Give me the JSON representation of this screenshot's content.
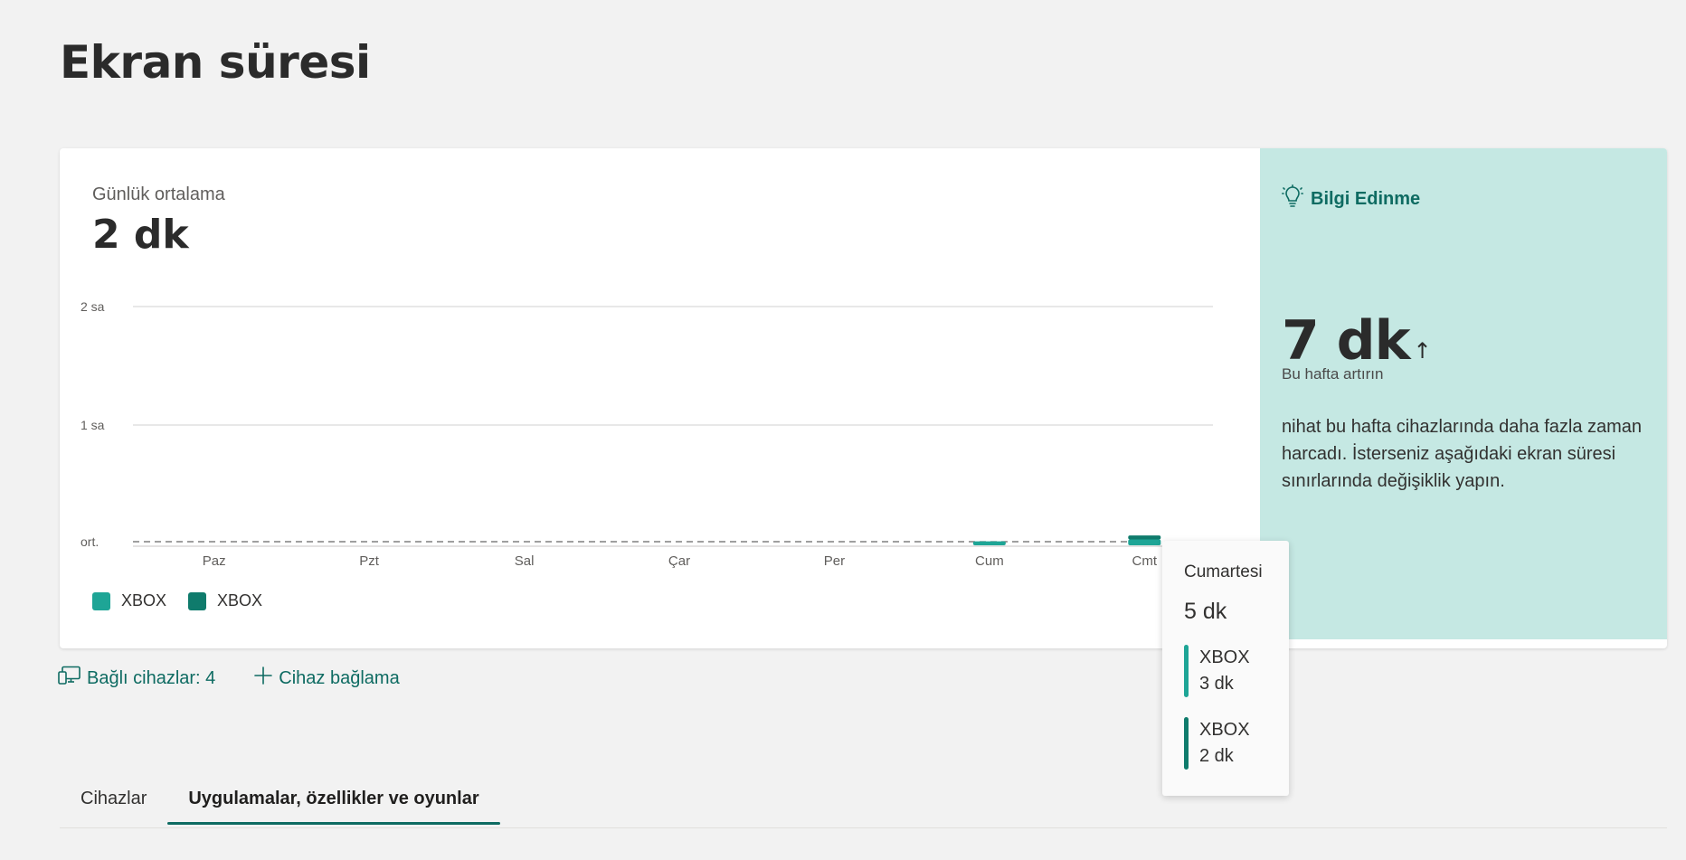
{
  "page": {
    "title": "Ekran süresi"
  },
  "summary": {
    "avg_label": "Günlük ortalama",
    "avg_value": "2 dk"
  },
  "chart_data": {
    "type": "bar",
    "stacked": true,
    "categories": [
      "Paz",
      "Pzt",
      "Sal",
      "Çar",
      "Per",
      "Cum",
      "Cmt"
    ],
    "y_ticks": [
      {
        "label": "2 sa",
        "minutes": 120
      },
      {
        "label": "1 sa",
        "minutes": 60
      }
    ],
    "avg_line": {
      "label": "ort.",
      "minutes": 2
    },
    "ylim": [
      0,
      120
    ],
    "series": [
      {
        "name": "XBOX",
        "color": "#1ea596",
        "values": [
          0,
          0,
          0,
          0,
          0,
          2,
          3
        ]
      },
      {
        "name": "XBOX",
        "color": "#0f7b6c",
        "values": [
          0,
          0,
          0,
          0,
          0,
          0,
          2
        ]
      }
    ]
  },
  "insight": {
    "title": "Bilgi Edinme",
    "value": "7 dk",
    "arrow": "↑",
    "subtitle": "Bu hafta artırın",
    "text": "nihat bu hafta cihazlarında daha fazla zaman harcadı. İsterseniz aşağıdaki ekran süresi sınırlarında değişiklik yapın.",
    "bg_color": "#c5e8e3",
    "accent_color": "#0e6b62"
  },
  "tooltip": {
    "day": "Cumartesi",
    "total": "5 dk",
    "rows": [
      {
        "name": "XBOX",
        "value": "3 dk",
        "color": "#1ea596"
      },
      {
        "name": "XBOX",
        "value": "2 dk",
        "color": "#0f7b6c"
      }
    ]
  },
  "links": {
    "devices": "Bağlı cihazlar: 4",
    "add_device": "Cihaz bağlama"
  },
  "tabs": [
    {
      "label": "Cihazlar",
      "active": false
    },
    {
      "label": "Uygulamalar, özellikler ve oyunlar",
      "active": true
    }
  ]
}
